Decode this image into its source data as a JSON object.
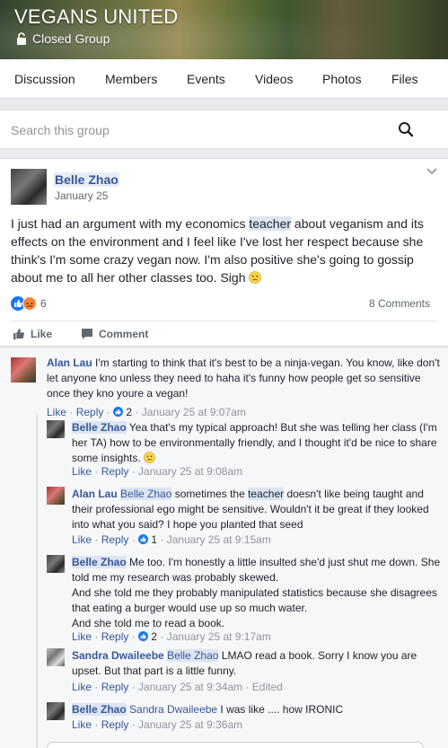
{
  "header": {
    "group_name": "VEGANS UNITED",
    "group_type": "Closed Group"
  },
  "tabs": [
    {
      "label": "Discussion"
    },
    {
      "label": "Members"
    },
    {
      "label": "Events"
    },
    {
      "label": "Videos"
    },
    {
      "label": "Photos"
    },
    {
      "label": "Files"
    }
  ],
  "search": {
    "placeholder": "Search this group"
  },
  "post": {
    "author": "Belle Zhao",
    "date": "January 25",
    "text_before": "I just had an argument with my economics ",
    "text_highlight": "teacher",
    "text_after": " about veganism and its effects on the environment and I feel like I've lost her respect because she think's I'm some crazy vegan now. I'm also positive she's going to gossip about me to all her other classes too. Sigh",
    "reaction_count": "6",
    "comments_count": "8 Comments",
    "like_label": "Like",
    "comment_label": "Comment"
  },
  "comments": [
    {
      "name": "Alan Lau",
      "text": " I'm starting to think that it's best to be a ninja-vegan. You know, like don't let anyone kno unless they need to haha it's funny how people get so sensitive once they kno youre a vegan!",
      "like": "Like",
      "reply": "Reply",
      "likes": "2",
      "time": "January 25 at 9:07am"
    },
    {
      "name": "Belle Zhao",
      "text": " Yea that's my typical approach! But she was telling her class (I'm her TA) how to be environmentally friendly, and I thought it'd be nice to share some insights.",
      "like": "Like",
      "reply": "Reply",
      "time": "January 25 at 9:08am"
    },
    {
      "name": "Alan Lau",
      "tag": "Belle Zhao",
      "text_before": " sometimes the ",
      "text_highlight": "teacher",
      "text_after": " doesn't like being taught and their professional ego might be sensitive. Wouldn't it be great if they looked into what you said? I hope you planted that seed",
      "like": "Like",
      "reply": "Reply",
      "likes": "1",
      "time": "January 25 at 9:15am"
    },
    {
      "name": "Belle Zhao",
      "text_lines": [
        " Me too. I'm honestly a little insulted she'd just shut me down. She told me my research was probably skewed.",
        "And she told me they probably manipulated statistics because she disagrees that eating a burger would use up so much water.",
        "And she told me to read a book."
      ],
      "like": "Like",
      "reply": "Reply",
      "likes": "2",
      "time": "January 25 at 9:17am"
    },
    {
      "name": "Sandra Dwaileebe",
      "tag": "Belle Zhao",
      "text": " LMAO read a book. Sorry I know you are upset. But that part is a little funny.",
      "like": "Like",
      "reply": "Reply",
      "time": "January 25 at 9:34am",
      "edited": "Edited"
    },
    {
      "name": "Belle Zhao",
      "tag": "Sandra Dwaileebe",
      "text": " I was like .... how IRONIC",
      "like": "Like",
      "reply": "Reply",
      "time": "January 25 at 9:36am"
    }
  ],
  "icons": {
    "lock": "lock-icon",
    "search": "search-icon",
    "menu": "chevron-down-icon",
    "like": "thumbs-up-icon",
    "comment": "comment-icon",
    "emoji": "disappointed-face-icon"
  },
  "colors": {
    "link": "#365899",
    "like_blue": "#1877f2",
    "angry_orange": "#f0863b",
    "muted": "#90949c"
  }
}
